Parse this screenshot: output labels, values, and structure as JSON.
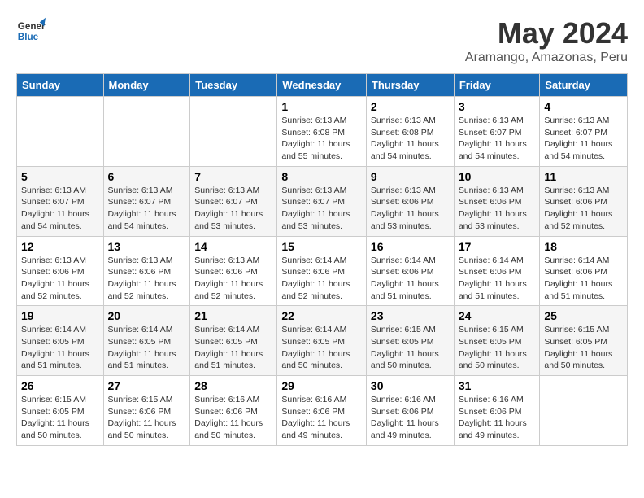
{
  "header": {
    "logo_line1": "General",
    "logo_line2": "Blue",
    "month_year": "May 2024",
    "location": "Aramango, Amazonas, Peru"
  },
  "days_of_week": [
    "Sunday",
    "Monday",
    "Tuesday",
    "Wednesday",
    "Thursday",
    "Friday",
    "Saturday"
  ],
  "weeks": [
    [
      {
        "day": "",
        "info": ""
      },
      {
        "day": "",
        "info": ""
      },
      {
        "day": "",
        "info": ""
      },
      {
        "day": "1",
        "info": "Sunrise: 6:13 AM\nSunset: 6:08 PM\nDaylight: 11 hours and 55 minutes."
      },
      {
        "day": "2",
        "info": "Sunrise: 6:13 AM\nSunset: 6:08 PM\nDaylight: 11 hours and 54 minutes."
      },
      {
        "day": "3",
        "info": "Sunrise: 6:13 AM\nSunset: 6:07 PM\nDaylight: 11 hours and 54 minutes."
      },
      {
        "day": "4",
        "info": "Sunrise: 6:13 AM\nSunset: 6:07 PM\nDaylight: 11 hours and 54 minutes."
      }
    ],
    [
      {
        "day": "5",
        "info": "Sunrise: 6:13 AM\nSunset: 6:07 PM\nDaylight: 11 hours and 54 minutes."
      },
      {
        "day": "6",
        "info": "Sunrise: 6:13 AM\nSunset: 6:07 PM\nDaylight: 11 hours and 54 minutes."
      },
      {
        "day": "7",
        "info": "Sunrise: 6:13 AM\nSunset: 6:07 PM\nDaylight: 11 hours and 53 minutes."
      },
      {
        "day": "8",
        "info": "Sunrise: 6:13 AM\nSunset: 6:07 PM\nDaylight: 11 hours and 53 minutes."
      },
      {
        "day": "9",
        "info": "Sunrise: 6:13 AM\nSunset: 6:06 PM\nDaylight: 11 hours and 53 minutes."
      },
      {
        "day": "10",
        "info": "Sunrise: 6:13 AM\nSunset: 6:06 PM\nDaylight: 11 hours and 53 minutes."
      },
      {
        "day": "11",
        "info": "Sunrise: 6:13 AM\nSunset: 6:06 PM\nDaylight: 11 hours and 52 minutes."
      }
    ],
    [
      {
        "day": "12",
        "info": "Sunrise: 6:13 AM\nSunset: 6:06 PM\nDaylight: 11 hours and 52 minutes."
      },
      {
        "day": "13",
        "info": "Sunrise: 6:13 AM\nSunset: 6:06 PM\nDaylight: 11 hours and 52 minutes."
      },
      {
        "day": "14",
        "info": "Sunrise: 6:13 AM\nSunset: 6:06 PM\nDaylight: 11 hours and 52 minutes."
      },
      {
        "day": "15",
        "info": "Sunrise: 6:14 AM\nSunset: 6:06 PM\nDaylight: 11 hours and 52 minutes."
      },
      {
        "day": "16",
        "info": "Sunrise: 6:14 AM\nSunset: 6:06 PM\nDaylight: 11 hours and 51 minutes."
      },
      {
        "day": "17",
        "info": "Sunrise: 6:14 AM\nSunset: 6:06 PM\nDaylight: 11 hours and 51 minutes."
      },
      {
        "day": "18",
        "info": "Sunrise: 6:14 AM\nSunset: 6:06 PM\nDaylight: 11 hours and 51 minutes."
      }
    ],
    [
      {
        "day": "19",
        "info": "Sunrise: 6:14 AM\nSunset: 6:05 PM\nDaylight: 11 hours and 51 minutes."
      },
      {
        "day": "20",
        "info": "Sunrise: 6:14 AM\nSunset: 6:05 PM\nDaylight: 11 hours and 51 minutes."
      },
      {
        "day": "21",
        "info": "Sunrise: 6:14 AM\nSunset: 6:05 PM\nDaylight: 11 hours and 51 minutes."
      },
      {
        "day": "22",
        "info": "Sunrise: 6:14 AM\nSunset: 6:05 PM\nDaylight: 11 hours and 50 minutes."
      },
      {
        "day": "23",
        "info": "Sunrise: 6:15 AM\nSunset: 6:05 PM\nDaylight: 11 hours and 50 minutes."
      },
      {
        "day": "24",
        "info": "Sunrise: 6:15 AM\nSunset: 6:05 PM\nDaylight: 11 hours and 50 minutes."
      },
      {
        "day": "25",
        "info": "Sunrise: 6:15 AM\nSunset: 6:05 PM\nDaylight: 11 hours and 50 minutes."
      }
    ],
    [
      {
        "day": "26",
        "info": "Sunrise: 6:15 AM\nSunset: 6:05 PM\nDaylight: 11 hours and 50 minutes."
      },
      {
        "day": "27",
        "info": "Sunrise: 6:15 AM\nSunset: 6:06 PM\nDaylight: 11 hours and 50 minutes."
      },
      {
        "day": "28",
        "info": "Sunrise: 6:16 AM\nSunset: 6:06 PM\nDaylight: 11 hours and 50 minutes."
      },
      {
        "day": "29",
        "info": "Sunrise: 6:16 AM\nSunset: 6:06 PM\nDaylight: 11 hours and 49 minutes."
      },
      {
        "day": "30",
        "info": "Sunrise: 6:16 AM\nSunset: 6:06 PM\nDaylight: 11 hours and 49 minutes."
      },
      {
        "day": "31",
        "info": "Sunrise: 6:16 AM\nSunset: 6:06 PM\nDaylight: 11 hours and 49 minutes."
      },
      {
        "day": "",
        "info": ""
      }
    ]
  ]
}
